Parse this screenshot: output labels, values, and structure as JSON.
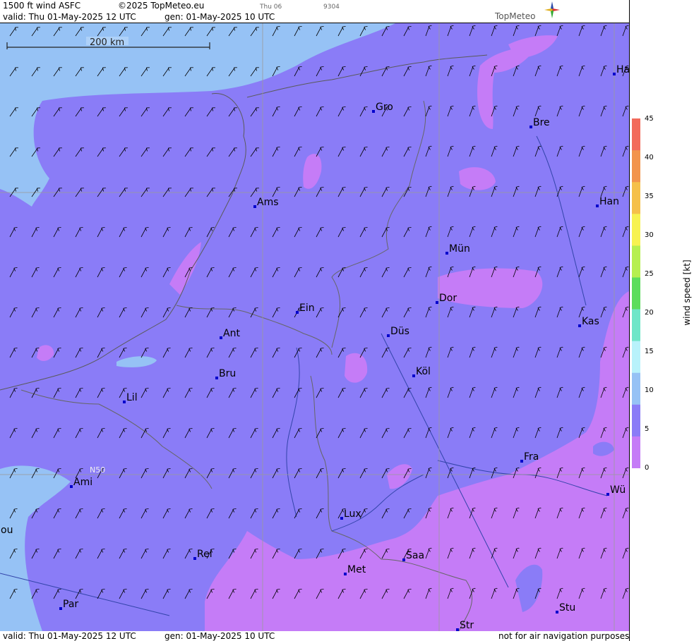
{
  "header": {
    "product": "1500 ft wind ASFC",
    "copyright": "©2025 TopMeteo.eu",
    "valid": "valid:  Thu  01-May-2025  12 UTC",
    "generated": "gen: 01-May-2025 10 UTC",
    "small_day": "Thu 06",
    "small_code": "9304",
    "brand": "TopMeteo"
  },
  "footer": {
    "valid": "valid:  Thu  01-May-2025  12 UTC",
    "generated": "gen: 01-May-2025 10 UTC",
    "disclaimer": "not for air navigation purposes"
  },
  "map": {
    "scale_label": "200 km",
    "latitude_label": "N50",
    "cities": [
      {
        "label": "Gro"
      },
      {
        "label": "Bre"
      },
      {
        "label": "Ha"
      },
      {
        "label": "Ams"
      },
      {
        "label": "Han"
      },
      {
        "label": "Mün"
      },
      {
        "label": "Dor"
      },
      {
        "label": "Ein"
      },
      {
        "label": "Kas"
      },
      {
        "label": "Ant"
      },
      {
        "label": "Düs"
      },
      {
        "label": "Bru"
      },
      {
        "label": "Köl"
      },
      {
        "label": "Lil"
      },
      {
        "label": "Fra"
      },
      {
        "label": "Ami"
      },
      {
        "label": "Wü"
      },
      {
        "label": "Lux"
      },
      {
        "label": "ou"
      },
      {
        "label": "Rei"
      },
      {
        "label": "Saa"
      },
      {
        "label": "Met"
      },
      {
        "label": "Stu"
      },
      {
        "label": "Par"
      },
      {
        "label": "Str"
      }
    ]
  },
  "legend": {
    "title": "wind  speed  [kt]",
    "unit": "kt",
    "ticks": [
      "45",
      "40",
      "35",
      "30",
      "25",
      "20",
      "15",
      "10",
      "5",
      "0"
    ],
    "colors": [
      "#f26b5b",
      "#f2944c",
      "#f5c04a",
      "#f7f250",
      "#b6ef4f",
      "#5cdd5c",
      "#6fe6c8",
      "#b8f2fb",
      "#96c2f5",
      "#8a7cf7",
      "#c57cf7"
    ]
  }
}
